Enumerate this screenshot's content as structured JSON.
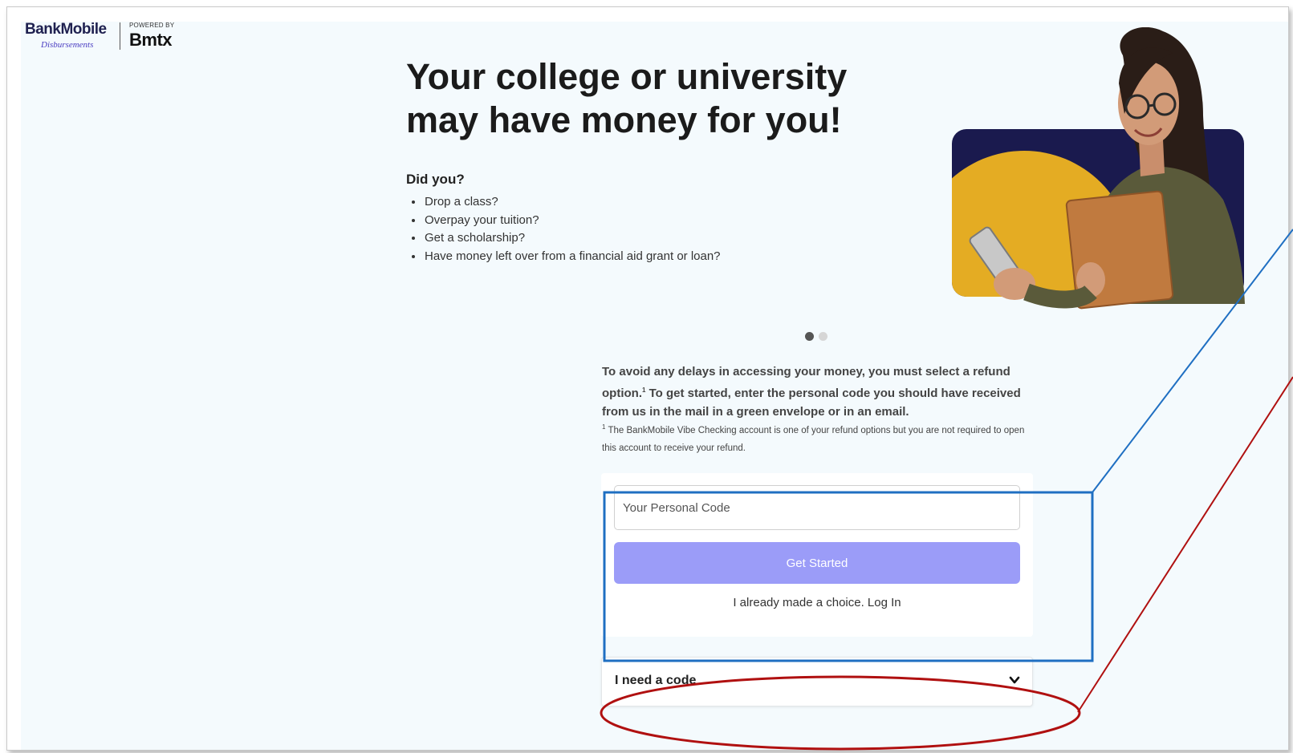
{
  "brand": {
    "name": "BankMobile",
    "subtitle": "Disbursements",
    "powered_by": "POWERED BY",
    "partner": "Bmtx"
  },
  "hero": {
    "headline": "Your college or university may have money for you!",
    "question": "Did you?",
    "bullets": [
      "Drop a class?",
      "Overpay your tuition?",
      "Get a scholarship?",
      "Have money left over from a financial aid grant or loan?"
    ]
  },
  "carousel": {
    "slide_count": 2,
    "active_index": 0
  },
  "intro": {
    "text_before": "To avoid any delays in accessing your money, you must select a refund option.",
    "marker": "1",
    "text_after": " To get started, enter the personal code you should have received from us in the mail in a green envelope or in an email.",
    "footnote_marker": "1",
    "footnote": " The BankMobile Vibe Checking account is one of your refund options but you are not required to open this account to receive your refund."
  },
  "form": {
    "code_placeholder": "Your Personal Code",
    "code_value": "",
    "submit_label": "Get Started",
    "login_link": "I already made a choice. Log In"
  },
  "accordion": {
    "need_code_label": "I need a code"
  },
  "colors": {
    "page_bg": "#f4fafd",
    "button": "#9b9cf8",
    "brand_navy": "#1a1a4e",
    "brand_gold": "#e4ac23",
    "annotation_blue": "#1f6fc2",
    "annotation_red": "#b01010"
  },
  "icons": {
    "chevron": "chevron-down-icon"
  }
}
